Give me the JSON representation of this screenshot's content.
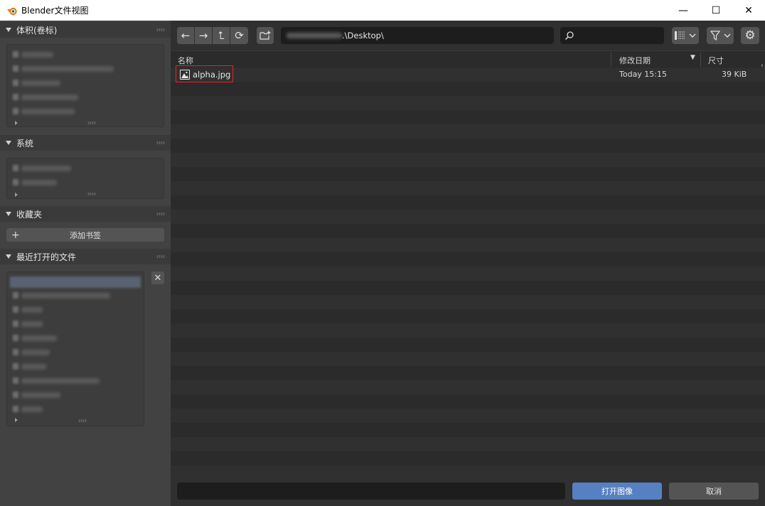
{
  "window": {
    "title": "Blender文件视图",
    "minimize": "—",
    "maximize": "☐",
    "close": "✕",
    "logo_icon": "blender-logo-icon",
    "accent": "#e87d0d"
  },
  "sidebar": {
    "volumes": {
      "title": "体积(卷标)"
    },
    "system": {
      "title": "系统"
    },
    "bookmarks": {
      "title": "收藏夹",
      "add_label": "添加书签",
      "add_icon": "+"
    },
    "recent": {
      "title": "最近打开的文件",
      "clear_icon": "✕"
    }
  },
  "toolbar": {
    "back": "←",
    "forward": "→",
    "parent": "⮤",
    "refresh": "⟳",
    "new_folder": "new-folder-icon",
    "path_suffix": ".\\Desktop\\",
    "search_icon": "⌕",
    "view_icon": "display-mode-icon",
    "filter_icon": "filter-icon",
    "settings_icon": "⚙",
    "chevron": "⌄"
  },
  "columns": {
    "name": "名称",
    "date": "修改日期",
    "size": "尺寸",
    "sort_icon": "▼"
  },
  "files": [
    {
      "name": "alpha.jpg",
      "date": "Today 15:15",
      "size": "39 KiB"
    }
  ],
  "footer": {
    "filename_value": "",
    "open_label": "打开图像",
    "cancel_label": "取消"
  },
  "colors": {
    "open_button": "#5680c2",
    "highlight": "#e0262a"
  }
}
